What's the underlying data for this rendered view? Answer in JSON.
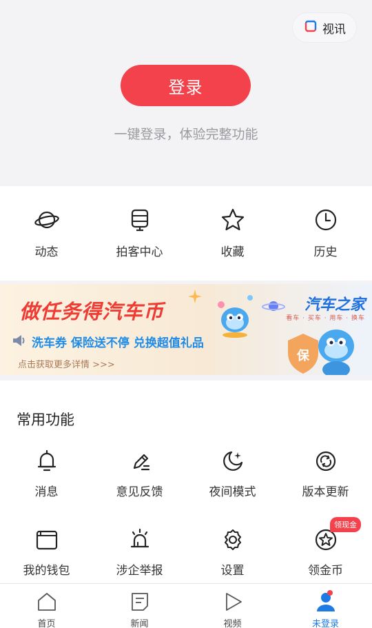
{
  "header": {
    "video_chip_label": "视讯",
    "login_label": "登录",
    "login_subtitle": "一键登录，体验完整功能"
  },
  "quick": {
    "items": [
      {
        "label": "动态",
        "icon": "planet-icon"
      },
      {
        "label": "拍客中心",
        "icon": "device-icon"
      },
      {
        "label": "收藏",
        "icon": "star-icon"
      },
      {
        "label": "历史",
        "icon": "clock-icon"
      }
    ]
  },
  "banner": {
    "title": "做任务得汽车币",
    "line": "洗车券 保险送不停 兑换超值礼品",
    "hint": "点击获取更多详情 >>>",
    "brand": "汽车之家",
    "brand_sub": "看车 · 买车 · 用车 · 换车",
    "shield_char": "保",
    "colors": {
      "title": "#ee3b33",
      "line": "#1e8be8",
      "brand": "#1e6fe0"
    }
  },
  "common": {
    "title": "常用功能",
    "rows": [
      [
        {
          "label": "消息",
          "icon": "bell-icon"
        },
        {
          "label": "意见反馈",
          "icon": "pen-icon"
        },
        {
          "label": "夜间模式",
          "icon": "moon-icon"
        },
        {
          "label": "版本更新",
          "icon": "refresh-icon"
        }
      ],
      [
        {
          "label": "我的钱包",
          "icon": "wallet-icon"
        },
        {
          "label": "涉企举报",
          "icon": "alarm-icon"
        },
        {
          "label": "设置",
          "icon": "gear-icon"
        },
        {
          "label": "领金币",
          "icon": "coin-star-icon",
          "badge": "领现金"
        }
      ]
    ]
  },
  "tabbar": {
    "tabs": [
      {
        "label": "首页",
        "icon": "home-icon"
      },
      {
        "label": "新闻",
        "icon": "news-icon"
      },
      {
        "label": "视频",
        "icon": "play-icon"
      },
      {
        "label": "未登录",
        "icon": "user-icon",
        "active": true
      }
    ]
  },
  "colors": {
    "accent": "#f3424b",
    "active_tab": "#1e7be3"
  }
}
